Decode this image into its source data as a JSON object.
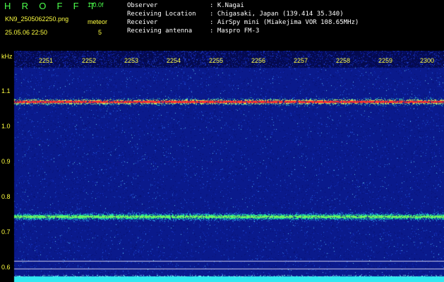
{
  "header": {
    "app_title": "H R O F F T",
    "version": "1.0.0f",
    "filename": "KN9_2505062250.png",
    "datetime": "25.05.06 22:50",
    "meteor_label": "meteor",
    "meteor_count": "5",
    "info_rows": [
      {
        "label": "Observer",
        "value": ": K.Nagai"
      },
      {
        "label": "Receiving Location",
        "value": ": Chigasaki, Japan (139.414 35.340)"
      },
      {
        "label": "Receiver",
        "value": ": AirSpy mini (Miakejima VOR 108.65MHz)"
      },
      {
        "label": "Receiving antenna",
        "value": ": Maspro FM-3"
      }
    ]
  },
  "axes": {
    "y_unit": "kHz",
    "y_ticks": [
      "1.1",
      "1.0",
      "0.9",
      "0.8",
      "0.7",
      "0.6"
    ],
    "x_ticks": [
      "2251",
      "2252",
      "2253",
      "2254",
      "2255",
      "2256",
      "2257",
      "2258",
      "2259",
      "2300"
    ]
  },
  "colors": {
    "background": "#000000",
    "label_yellow": "#FFFF40",
    "title_green": "#4CFF4C",
    "waterfall_base": "#0A1A8C",
    "signal_line": "#FF3030",
    "meteor_band": "#20E0A0",
    "bottom_strip": "#30E8F0"
  }
}
